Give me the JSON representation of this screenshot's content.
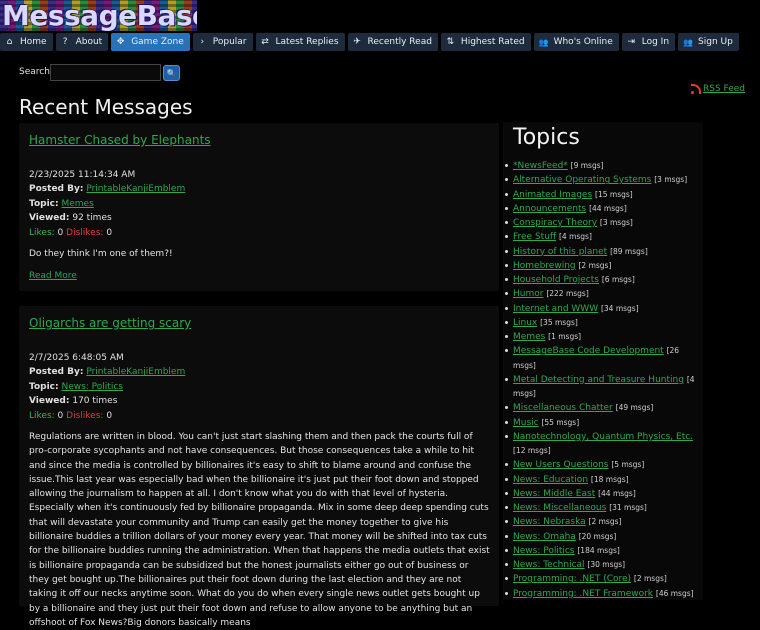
{
  "logo": {
    "text": "MessageBase"
  },
  "nav": [
    {
      "label": "Home",
      "icon": "home-icon",
      "glyph": "⌂",
      "active": false
    },
    {
      "label": "About",
      "icon": "question-icon",
      "glyph": "?",
      "active": false
    },
    {
      "label": "Game Zone",
      "icon": "gamepad-icon",
      "glyph": "✥",
      "active": true
    },
    {
      "label": "Popular",
      "icon": "chevron-right-icon",
      "glyph": "›",
      "active": false
    },
    {
      "label": "Latest Replies",
      "icon": "exchange-icon",
      "glyph": "⇄",
      "active": false
    },
    {
      "label": "Recently Read",
      "icon": "plane-icon",
      "glyph": "✈",
      "active": false
    },
    {
      "label": "Highest Rated",
      "icon": "sort-icon",
      "glyph": "⇅",
      "active": false
    },
    {
      "label": "Who's Online",
      "icon": "users-icon",
      "glyph": "👥",
      "active": false
    },
    {
      "label": "Log In",
      "icon": "sign-in-icon",
      "glyph": "⇥",
      "active": false
    },
    {
      "label": "Sign Up",
      "icon": "user-plus-icon",
      "glyph": "👥",
      "active": false
    }
  ],
  "search": {
    "label": "Search",
    "value": "",
    "placeholder": "",
    "button_glyph": "🔍"
  },
  "rss": {
    "label": "RSS Feed"
  },
  "recent": {
    "title": "Recent Messages"
  },
  "messages": [
    {
      "title": "Hamster Chased by Elephants",
      "date": "2/23/2025 11:14:34 AM",
      "posted_by_label": "Posted By:",
      "posted_by": "PrintableKanjiEmblem",
      "topic_label": "Topic:",
      "topic": "Memes",
      "viewed_label": "Viewed:",
      "viewed": "92 times",
      "likes_label": "Likes:",
      "likes": "0",
      "dislikes_label": "Dislikes:",
      "dislikes": "0",
      "body": "Do they think I'm one of them?!",
      "read_more": "Read More"
    },
    {
      "title": "Oligarchs are getting scary",
      "date": "2/7/2025 6:48:05 AM",
      "posted_by_label": "Posted By:",
      "posted_by": "PrintableKanjiEmblem",
      "topic_label": "Topic:",
      "topic": "News: Politics",
      "viewed_label": "Viewed:",
      "viewed": "170 times",
      "likes_label": "Likes:",
      "likes": "0",
      "dislikes_label": "Dislikes:",
      "dislikes": "0",
      "body": "Regulations are written in blood. You can't just start slashing them and then pack the courts full of pro-corporate sycophants and not have consequences. But those consequences take a while to hit and since the media is controlled by billionaires it's easy to shift to blame around and confuse the issue.This last year was especially bad when the billionaire it's just put their foot down and stopped allowing the journalism to happen at all. I don't know what you do with that level of hysteria. Especially when it's continuously fed by billionaire propaganda. Mix in some deep deep spending cuts that will devastate your community and Trump can easily get the money together to give his billionaire buddies a trillion dollars of your money every year. That money will be shifted into tax cuts for the billionaire buddies running the administration. When that happens the media outlets that exist is billionaire propaganda can be subsidized but the honest journalists either go out of business or they get bought up.The billionaires put their foot down during the last election and they are not taking it off our necks anytime soon. What do you do when every single news outlet gets bought up by a billionaire and they just put their foot down and refuse to allow anyone to be anything but an offshoot of Fox News?Big donors basically means"
    }
  ],
  "topics": {
    "title": "Topics",
    "items": [
      {
        "name": "*NewsFeed*",
        "count": "[9 msgs]"
      },
      {
        "name": "Alternative Operating Systems",
        "count": "[3 msgs]"
      },
      {
        "name": "Animated Images",
        "count": "[15 msgs]"
      },
      {
        "name": "Announcements",
        "count": "[44 msgs]"
      },
      {
        "name": "Conspiracy Theory",
        "count": "[3 msgs]"
      },
      {
        "name": "Free Stuff",
        "count": "[4 msgs]"
      },
      {
        "name": "History of this planet",
        "count": "[89 msgs]"
      },
      {
        "name": "Homebrewing",
        "count": "[2 msgs]"
      },
      {
        "name": "Household Projects",
        "count": "[6 msgs]"
      },
      {
        "name": "Humor",
        "count": "[222 msgs]"
      },
      {
        "name": "Internet and WWW",
        "count": "[34 msgs]"
      },
      {
        "name": "Linux",
        "count": "[35 msgs]"
      },
      {
        "name": "Memes",
        "count": "[1 msgs]"
      },
      {
        "name": "MessageBase Code Development",
        "count": "[26 msgs]"
      },
      {
        "name": "Metal Detecting and Treasure Hunting",
        "count": "[4 msgs]"
      },
      {
        "name": "Miscellaneous Chatter",
        "count": "[49 msgs]"
      },
      {
        "name": "Music",
        "count": "[55 msgs]"
      },
      {
        "name": "Nanotechnology, Quantum Physics, Etc.",
        "count": "[12 msgs]"
      },
      {
        "name": "New Users Questions",
        "count": "[5 msgs]"
      },
      {
        "name": "News: Education",
        "count": "[18 msgs]"
      },
      {
        "name": "News: Middle East",
        "count": "[44 msgs]"
      },
      {
        "name": "News: Miscellaneous",
        "count": "[31 msgs]"
      },
      {
        "name": "News: Nebraska",
        "count": "[2 msgs]"
      },
      {
        "name": "News: Omaha",
        "count": "[20 msgs]"
      },
      {
        "name": "News: Politics",
        "count": "[184 msgs]"
      },
      {
        "name": "News: Technical",
        "count": "[30 msgs]"
      },
      {
        "name": "Programming: .NET (Core)",
        "count": "[2 msgs]"
      },
      {
        "name": "Programming: .NET Framework",
        "count": "[46 msgs]"
      }
    ]
  },
  "colors": {
    "link": "#2fa84f",
    "nav_bg": "#1d2b3c",
    "nav_active": "#2a72b8",
    "likes": "#32b84a",
    "dislikes": "#e03a3a"
  }
}
